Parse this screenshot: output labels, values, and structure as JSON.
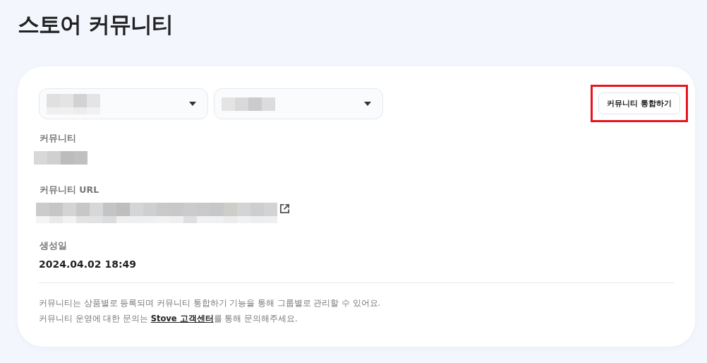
{
  "page_title": "스토어 커뮤니티",
  "merge_button": {
    "label": "커뮤니티 통합하기",
    "highlighted": true
  },
  "fields": [
    {
      "label": "커뮤니티",
      "kind": "text"
    },
    {
      "label": "커뮤니티 URL",
      "kind": "link"
    },
    {
      "label": "생성일",
      "kind": "value",
      "value": "2024.04.02 18:49"
    }
  ],
  "notes": [
    {
      "text": "커뮤니티는 상품별로 등록되며 커뮤니티 통합하기 기능을 통해 그룹별로 관리할 수 있어요."
    },
    {
      "text": "커뮤니티 운영에 대한 문의는 ",
      "link": "Stove 고객센터",
      "after": "를 통해 문의해주세요."
    }
  ]
}
